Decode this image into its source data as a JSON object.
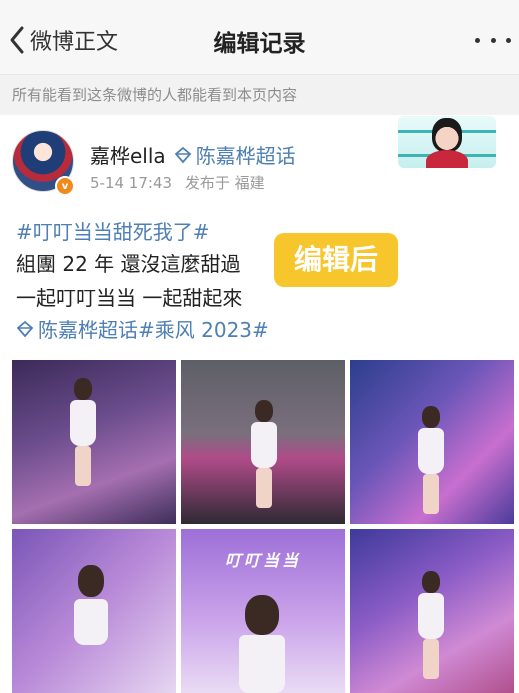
{
  "nav": {
    "back_label": "微博正文",
    "title": "编辑记录"
  },
  "notice": "所有能看到这条微博的人都能看到本页内容",
  "post": {
    "username": "嘉桦ella",
    "topic_name": "陈嘉桦超话",
    "time": "5-14 17:43",
    "location": "发布于 福建",
    "hashtag_line": "#叮叮当当甜死我了#",
    "line2": "組團 22 年 還沒這麼甜過",
    "line3": "一起叮叮当当 一起甜起來",
    "topic_tag_text": "陈嘉桦超话#乘风 2023#",
    "edit_tag": "编辑后",
    "poster_title": "叮叮当当"
  },
  "colors": {
    "link": "#4e7fb5",
    "edit_tag_bg": "#f7c52c",
    "nav_bg": "#f7f7f7",
    "notice_bg": "#f2f2f2"
  },
  "icons": [
    "chevron-left-icon",
    "more-dots-icon",
    "topic-diamond-icon",
    "verified-badge-icon"
  ]
}
